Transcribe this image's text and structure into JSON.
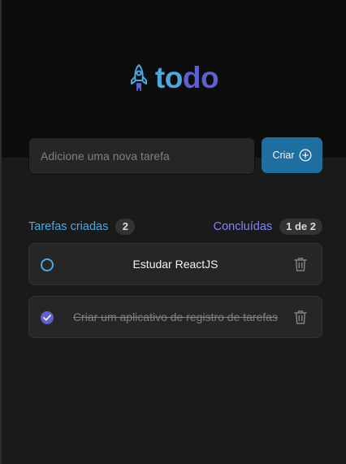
{
  "header": {
    "logo_icon": "rocket-icon",
    "logo_part1": "to",
    "logo_part2": "do",
    "colors": {
      "to": "#4ea8de",
      "do": "#5e60ce",
      "background": "#0d0d0d"
    }
  },
  "form": {
    "placeholder": "Adicione uma nova tarefa",
    "value": "",
    "create_label": "Criar",
    "create_icon": "plus-circle-icon"
  },
  "info": {
    "created_label": "Tarefas criadas",
    "created_count": "2",
    "done_label": "Concluídas",
    "done_count": "1 de 2"
  },
  "tasks": [
    {
      "text": "Estudar ReactJS",
      "completed": false
    },
    {
      "text": "Criar um aplicativo de registro de tarefas",
      "completed": true
    }
  ]
}
